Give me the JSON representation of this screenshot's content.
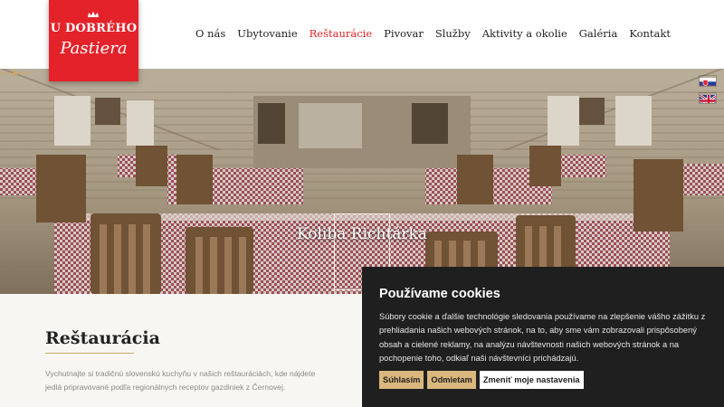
{
  "logo": {
    "line1": "U DOBRÉHO",
    "line2": "Pastiera",
    "color": "#e3222a"
  },
  "nav": {
    "items": [
      {
        "label": "O nás"
      },
      {
        "label": "Ubytovanie"
      },
      {
        "label": "Reštaurácie",
        "active": true
      },
      {
        "label": "Pivovar"
      },
      {
        "label": "Služby"
      },
      {
        "label": "Aktivity a okolie"
      },
      {
        "label": "Galéria"
      },
      {
        "label": "Kontakt"
      }
    ],
    "active_color": "#d9232b"
  },
  "hero": {
    "title": "Koliba Richtárka"
  },
  "flags": [
    {
      "name": "slovak-flag-icon"
    },
    {
      "name": "english-flag-icon"
    }
  ],
  "section": {
    "title": "Reštaurácia",
    "text": "Vychutnajte si tradičnú slovenskú kuchyňu v našich reštauráciách, kde nájdete jedlá pripravované podľa regionálnych receptov gazdiniek z Černovej."
  },
  "cookie": {
    "title": "Používame cookies",
    "text": "Súbory cookie a ďalšie technológie sledovania používame na zlepšenie vášho zážitku z prehliadania našich webových stránok, na to, aby sme vám zobrazovali prispôsobený obsah a cielené reklamy, na analýzu návštevnosti našich webových stránok a na pochopenie toho, odkiaľ naši návštevníci prichádzajú.",
    "accept_label": "Súhlasím",
    "reject_label": "Odmietam",
    "settings_label": "Zmeniť moje nastavenia",
    "accent_color": "#d9b77d"
  }
}
